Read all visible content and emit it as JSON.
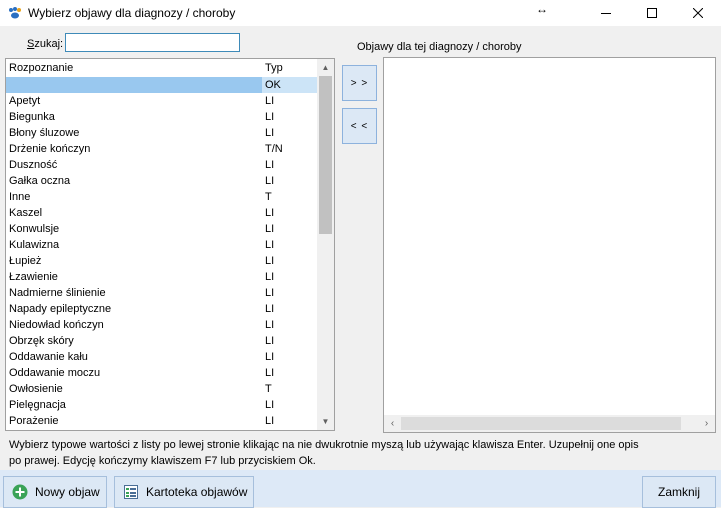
{
  "window": {
    "title": "Wybierz objawy dla diagnozy / choroby",
    "minimize_glyph": "—",
    "maximize_glyph": "☐",
    "close_glyph": "✕",
    "resize_glyph": "↔"
  },
  "search": {
    "label_key": "S",
    "label_rest": "zukaj:",
    "value": "",
    "placeholder": ""
  },
  "left_list": {
    "columns": [
      "Rozpoznanie",
      "Typ"
    ],
    "rows": [
      {
        "name": "",
        "type": "OK"
      },
      {
        "name": "Apetyt",
        "type": "LI"
      },
      {
        "name": "Biegunka",
        "type": "LI"
      },
      {
        "name": "Błony śluzowe",
        "type": "LI"
      },
      {
        "name": "Drżenie kończyn",
        "type": "T/N"
      },
      {
        "name": "Duszność",
        "type": "LI"
      },
      {
        "name": "Gałka oczna",
        "type": "LI"
      },
      {
        "name": "Inne",
        "type": "T"
      },
      {
        "name": "Kaszel",
        "type": "LI"
      },
      {
        "name": "Konwulsje",
        "type": "LI"
      },
      {
        "name": "Kulawizna",
        "type": "LI"
      },
      {
        "name": "Łupież",
        "type": "LI"
      },
      {
        "name": "Łzawienie",
        "type": "LI"
      },
      {
        "name": "Nadmierne ślinienie",
        "type": "LI"
      },
      {
        "name": "Napady epileptyczne",
        "type": "LI"
      },
      {
        "name": "Niedowład kończyn",
        "type": "LI"
      },
      {
        "name": "Obrzęk skóry",
        "type": "LI"
      },
      {
        "name": "Oddawanie kału",
        "type": "LI"
      },
      {
        "name": "Oddawanie moczu",
        "type": "LI"
      },
      {
        "name": "Owłosienie",
        "type": "T"
      },
      {
        "name": "Pielęgnacja",
        "type": "LI"
      },
      {
        "name": "Porażenie",
        "type": "LI"
      }
    ]
  },
  "right_list": {
    "label": "Objawy dla tej diagnozy / choroby"
  },
  "move_buttons": {
    "add": "> >",
    "remove": "< <"
  },
  "help_text": {
    "line1": "Wybierz typowe wartości z listy po lewej stronie klikając na nie dwukrotnie myszą lub używając klawisza Enter. Uzupełnij one opis",
    "line2": "po prawej. Edycję kończymy klawiszem F7 lub przyciskiem Ok."
  },
  "buttons": {
    "new_symptom": "Nowy objaw",
    "symptom_card": "Kartoteka objawów",
    "close": "Zamknij"
  },
  "colors": {
    "selection": "#99c8ef",
    "accent_green": "#3aa357",
    "bottom_bar": "#dde9f7"
  }
}
